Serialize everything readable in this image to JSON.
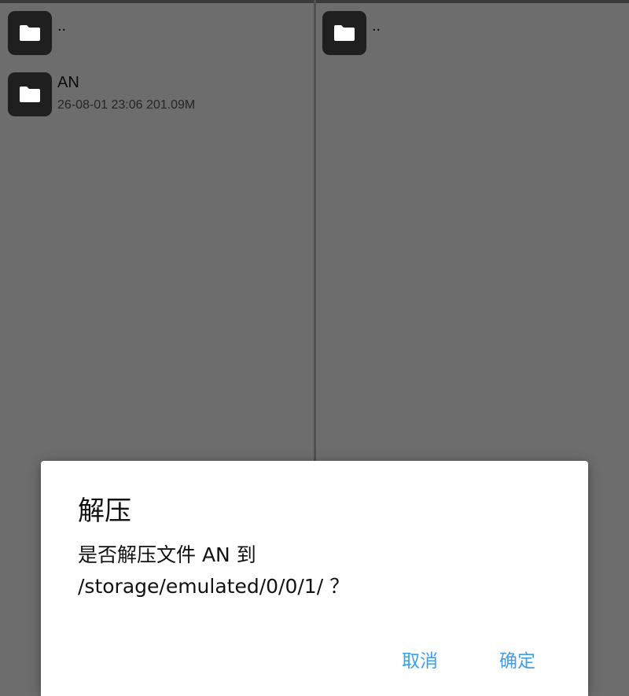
{
  "left_pane": {
    "items": [
      {
        "name": "..",
        "meta": "",
        "icon": "folder-icon"
      },
      {
        "name": "AN",
        "meta": "26-08-01 23:06  201.09M",
        "icon": "folder-icon"
      }
    ]
  },
  "right_pane": {
    "items": [
      {
        "name": "..",
        "icon": "folder-icon"
      }
    ]
  },
  "dialog": {
    "title": "解压",
    "message_line1": "是否解压文件 AN 到",
    "message_line2": "/storage/emulated/0/0/1/ ？",
    "cancel_label": "取消",
    "confirm_label": "确定",
    "button_color": "#3f9fe6"
  }
}
